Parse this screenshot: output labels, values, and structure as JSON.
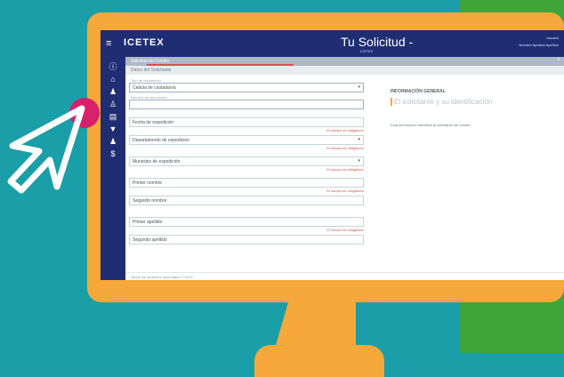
{
  "window": {
    "logo_text": "ICETEX",
    "app_title": "Tu Solicitud -",
    "app_subtitle": "ICETEX",
    "user_name": "Usuario",
    "user_email": "Nombre Apellido Apellido"
  },
  "sidebar": {
    "items": [
      {
        "icon": "info-icon"
      },
      {
        "icon": "home-icon"
      },
      {
        "icon": "group-icon"
      },
      {
        "icon": "people-icon"
      },
      {
        "icon": "document-icon"
      },
      {
        "icon": "filter-icon"
      },
      {
        "icon": "group-icon-2"
      },
      {
        "icon": "money-icon"
      }
    ]
  },
  "section": {
    "title": "Solicitud de Crédito",
    "close": "×",
    "subtitle": "Datos del Solicitante"
  },
  "form": {
    "fields": [
      {
        "label": "Tipo de documento",
        "value": "Cédula de ciudadanía",
        "kind": "select",
        "error": ""
      },
      {
        "label": "Número de documento",
        "value": "",
        "kind": "input",
        "error": ""
      },
      {
        "label": "",
        "value": "Fecha de expedición",
        "kind": "input",
        "error": "El campo es obligatorio"
      },
      {
        "label": "",
        "value": "Departamento de expedición",
        "kind": "select",
        "error": "El campo es obligatorio"
      },
      {
        "label": "",
        "value": "Municipio de expedición",
        "kind": "select",
        "error": "El campo es obligatorio"
      },
      {
        "label": "",
        "value": "Primer nombre",
        "kind": "input",
        "error": "El campo es obligatorio"
      },
      {
        "label": "",
        "value": "Segundo nombre",
        "kind": "input",
        "error": ""
      },
      {
        "label": "",
        "value": "Primer apellido",
        "kind": "input",
        "error": "El campo es obligatorio"
      },
      {
        "label": "",
        "value": "Segundo apellido",
        "kind": "input",
        "error": ""
      }
    ]
  },
  "right": {
    "title": "INFORMACIÓN GENERAL",
    "subtitle": "El solicitante y su identificación",
    "note": "Esta información identifica al solicitante del crédito."
  },
  "footer": {
    "text": "Todos los derechos reservados © 2019"
  },
  "colors": {
    "background": "#1a9ea8",
    "monitor": "#f7a83a",
    "green_panel": "#3fa43a",
    "navbar": "#1f2d73",
    "cursor_dot": "#d6216a",
    "error": "#d9534f"
  }
}
